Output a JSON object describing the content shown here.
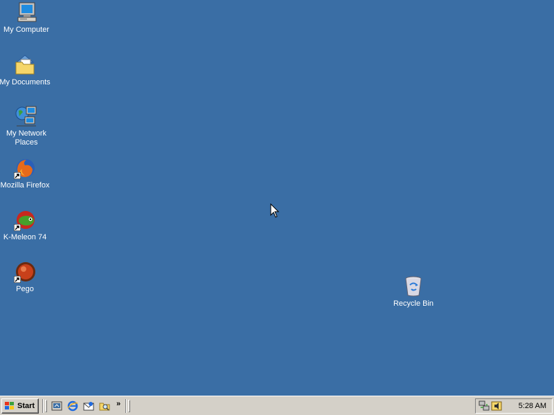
{
  "desktop": {
    "background_color": "#3a6ea5",
    "icons": [
      {
        "name": "my-computer",
        "label": "My Computer",
        "icon": "computer-icon"
      },
      {
        "name": "my-documents",
        "label": "My Documents",
        "icon": "folder-documents-icon"
      },
      {
        "name": "my-network-places",
        "label": "My Network Places",
        "icon": "network-places-icon"
      },
      {
        "name": "mozilla-firefox",
        "label": "Mozilla Firefox",
        "icon": "firefox-icon",
        "shortcut": true
      },
      {
        "name": "k-meleon",
        "label": "K-Meleon 74",
        "icon": "k-meleon-icon",
        "shortcut": true
      },
      {
        "name": "pego",
        "label": "Pego",
        "icon": "pego-icon",
        "shortcut": true
      },
      {
        "name": "recycle-bin",
        "label": "Recycle Bin",
        "icon": "recycle-bin-icon"
      }
    ]
  },
  "taskbar": {
    "start_label": "Start",
    "quick_launch": [
      {
        "name": "show-desktop",
        "icon": "show-desktop-icon"
      },
      {
        "name": "internet-explorer",
        "icon": "internet-explorer-icon"
      },
      {
        "name": "outlook-express",
        "icon": "outlook-express-icon"
      },
      {
        "name": "explorer-search",
        "icon": "explorer-search-icon"
      }
    ],
    "quick_launch_more": "»",
    "tray_icons": [
      {
        "name": "network-connection",
        "icon": "network-tray-icon"
      },
      {
        "name": "volume",
        "icon": "volume-tray-icon"
      }
    ],
    "clock": "5:28 AM"
  }
}
